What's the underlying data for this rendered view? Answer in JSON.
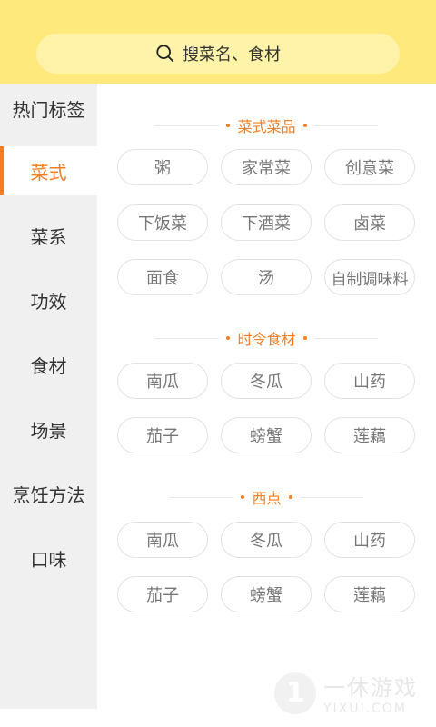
{
  "search": {
    "placeholder": "搜菜名、食材"
  },
  "sidebar": {
    "items": [
      {
        "label": "热门标签"
      },
      {
        "label": "菜式"
      },
      {
        "label": "菜系"
      },
      {
        "label": "功效"
      },
      {
        "label": "食材"
      },
      {
        "label": "场景"
      },
      {
        "label": "烹饪方法"
      },
      {
        "label": "口味"
      }
    ],
    "active_index": 1
  },
  "sections": [
    {
      "title": "菜式菜品",
      "chips": [
        "粥",
        "家常菜",
        "创意菜",
        "下饭菜",
        "下酒菜",
        "卤菜",
        "面食",
        "汤",
        "自制调味料"
      ]
    },
    {
      "title": "时令食材",
      "chips": [
        "南瓜",
        "冬瓜",
        "山药",
        "茄子",
        "螃蟹",
        "莲藕"
      ]
    },
    {
      "title": "西点",
      "chips": [
        "南瓜",
        "冬瓜",
        "山药",
        "茄子",
        "螃蟹",
        "莲藕"
      ]
    }
  ],
  "watermark": {
    "cn": "一休游戏",
    "en": "YIXUI.COM"
  },
  "colors": {
    "accent": "#f57c1f",
    "header": "#fde97c",
    "search_bg": "#fef3a9"
  }
}
